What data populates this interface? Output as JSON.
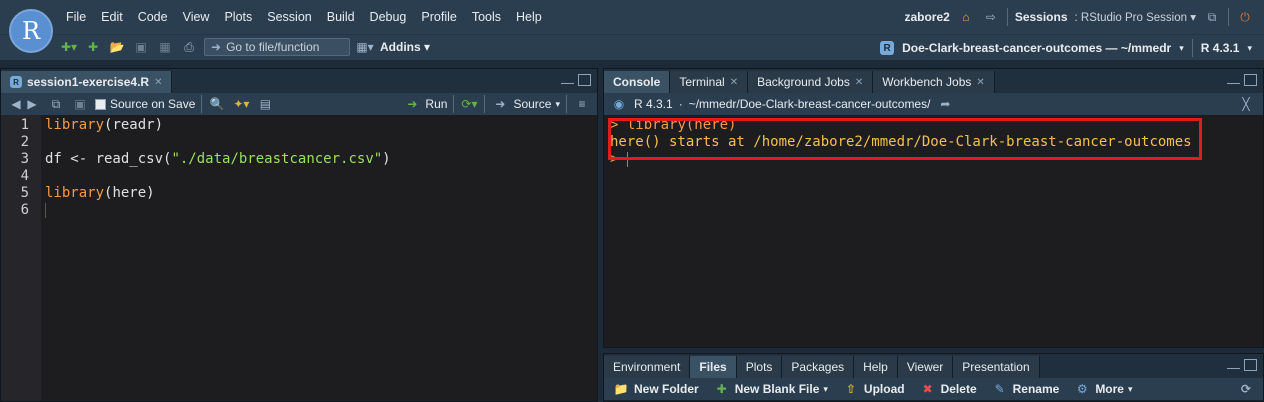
{
  "menubar": {
    "logo_letter": "R",
    "items": [
      "File",
      "Edit",
      "Code",
      "View",
      "Plots",
      "Session",
      "Build",
      "Debug",
      "Profile",
      "Tools",
      "Help"
    ],
    "user": "zabore2",
    "sessions_label": "Sessions",
    "session_name": "RStudio Pro Session"
  },
  "toolbar": {
    "goto_placeholder": "Go to file/function",
    "addins_label": "Addins",
    "project_name": "Doe-Clark-breast-cancer-outcomes — ~/mmedr",
    "r_version": "R 4.3.1"
  },
  "editor": {
    "tab_label": "session1-exercise4.R",
    "source_on_save": "Source on Save",
    "run_label": "Run",
    "source_label": "Source",
    "line_numbers": [
      "1",
      "2",
      "3",
      "4",
      "5",
      "6"
    ],
    "lines": [
      {
        "fn": "library",
        "rest": "(readr)"
      },
      {
        "plain": ""
      },
      {
        "pre": "df <- ",
        "fn": "read_csv",
        "open": "(",
        "str": "\"./data/breastcancer.csv\"",
        "close": ")"
      },
      {
        "plain": ""
      },
      {
        "fn": "library",
        "rest": "(here)"
      },
      {
        "plain": ""
      }
    ]
  },
  "console": {
    "tabs": [
      "Console",
      "Terminal",
      "Background Jobs",
      "Workbench Jobs"
    ],
    "r_version": "R 4.3.1",
    "path": "~/mmedr/Doe-Clark-breast-cancer-outcomes/",
    "prompt": ">",
    "command": "library(here)",
    "output": "here() starts at /home/zabore2/mmedr/Doe-Clark-breast-cancer-outcomes",
    "highlight_color": "#e21b1b"
  },
  "files_pane": {
    "tabs": [
      "Environment",
      "Files",
      "Plots",
      "Packages",
      "Help",
      "Viewer",
      "Presentation"
    ],
    "actions": [
      "New Folder",
      "New Blank File",
      "Upload",
      "Delete",
      "Rename",
      "More"
    ]
  }
}
